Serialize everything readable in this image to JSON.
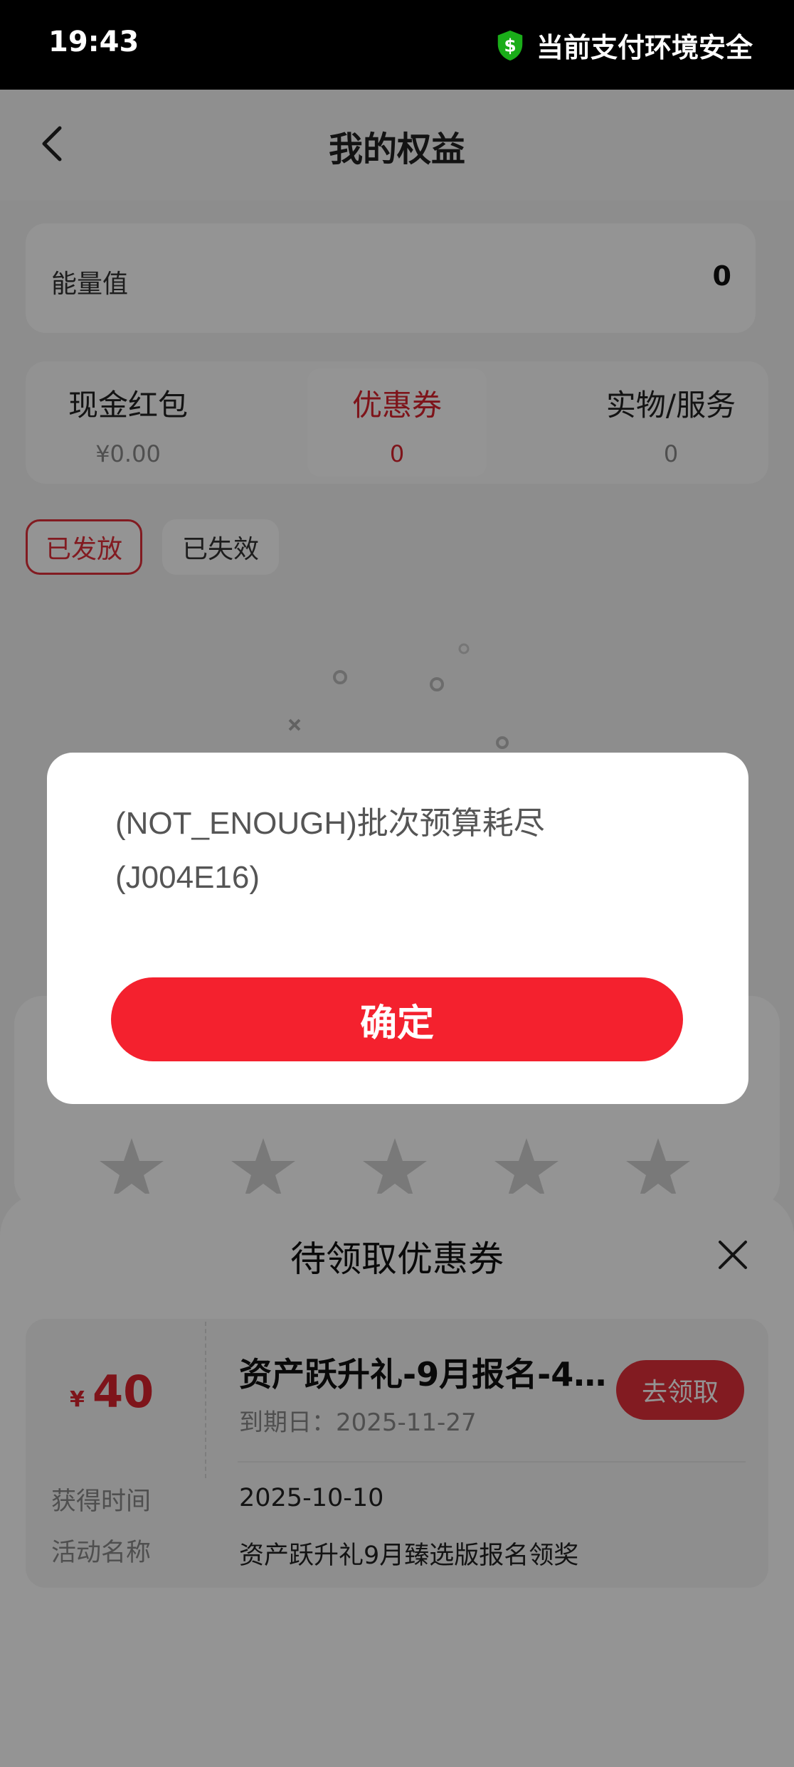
{
  "status_bar": {
    "time": "19:43",
    "security_text": "当前支付环境安全"
  },
  "header": {
    "title": "我的权益"
  },
  "energy": {
    "label": "能量值",
    "value": "0"
  },
  "tabs": [
    {
      "label": "现金红包",
      "value": "¥0.00"
    },
    {
      "label": "优惠券",
      "value": "0"
    },
    {
      "label": "实物/服务",
      "value": "0"
    }
  ],
  "filters": {
    "issued": "已发放",
    "expired": "已失效"
  },
  "colors": {
    "accent": "#e0303a",
    "button_red": "#f4212e",
    "status_bar": "#000000",
    "shield_green": "#1aad19"
  },
  "sheet": {
    "title": "待领取优惠券",
    "coupon": {
      "currency": "¥",
      "amount": "40",
      "name": "资产跃升礼-9月报名-40...",
      "expiry": "到期日：2025-11-27",
      "claim_label": "去领取",
      "obtained_label": "获得时间",
      "obtained_value": "2025-10-10",
      "activity_label": "活动名称",
      "activity_value": "资产跃升礼9月臻选版报名领奖"
    }
  },
  "dialog": {
    "message_line1": "(NOT_ENOUGH)批次预算耗尽",
    "message_line2": "(J004E16)",
    "confirm_label": "确定"
  }
}
